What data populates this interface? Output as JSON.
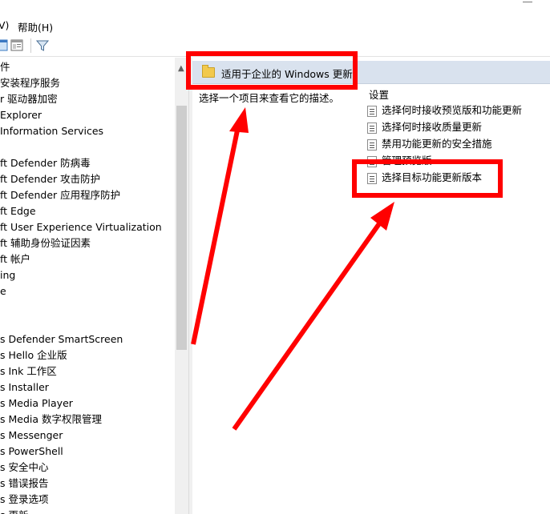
{
  "menu": {
    "view_label": "V)",
    "help_label": "帮助(H)"
  },
  "tree": {
    "items": [
      "件",
      "安装程序服务",
      "r 驱动器加密",
      "Explorer",
      "Information Services",
      "",
      "ft Defender 防病毒",
      "ft Defender 攻击防护",
      "ft Defender 应用程序防护",
      "ft Edge",
      "ft User Experience Virtualization",
      "ft 辅助身份验证因素",
      "ft 帐户",
      "ing",
      "e",
      "",
      "",
      "s Defender SmartScreen",
      "s Hello 企业版",
      "s Ink 工作区",
      "s Installer",
      "s Media Player",
      "s Media 数字权限管理",
      "s Messenger",
      "s PowerShell",
      "s 安全中心",
      "s 错误报告",
      "s 登录选项",
      "s 更新"
    ]
  },
  "details": {
    "header_title": "适用于企业的 Windows 更新",
    "description": "选择一个项目来查看它的描述。",
    "settings_header": "设置",
    "settings": [
      "选择何时接收预览版和功能更新",
      "选择何时接收质量更新",
      "禁用功能更新的安全措施",
      "管理预览版",
      "选择目标功能更新版本"
    ]
  },
  "annotation": {
    "color": "#ff0000"
  },
  "icons": [
    "folder-icon",
    "filter-icon",
    "console-tree-icon",
    "properties-icon",
    "setting-policy-icon"
  ]
}
